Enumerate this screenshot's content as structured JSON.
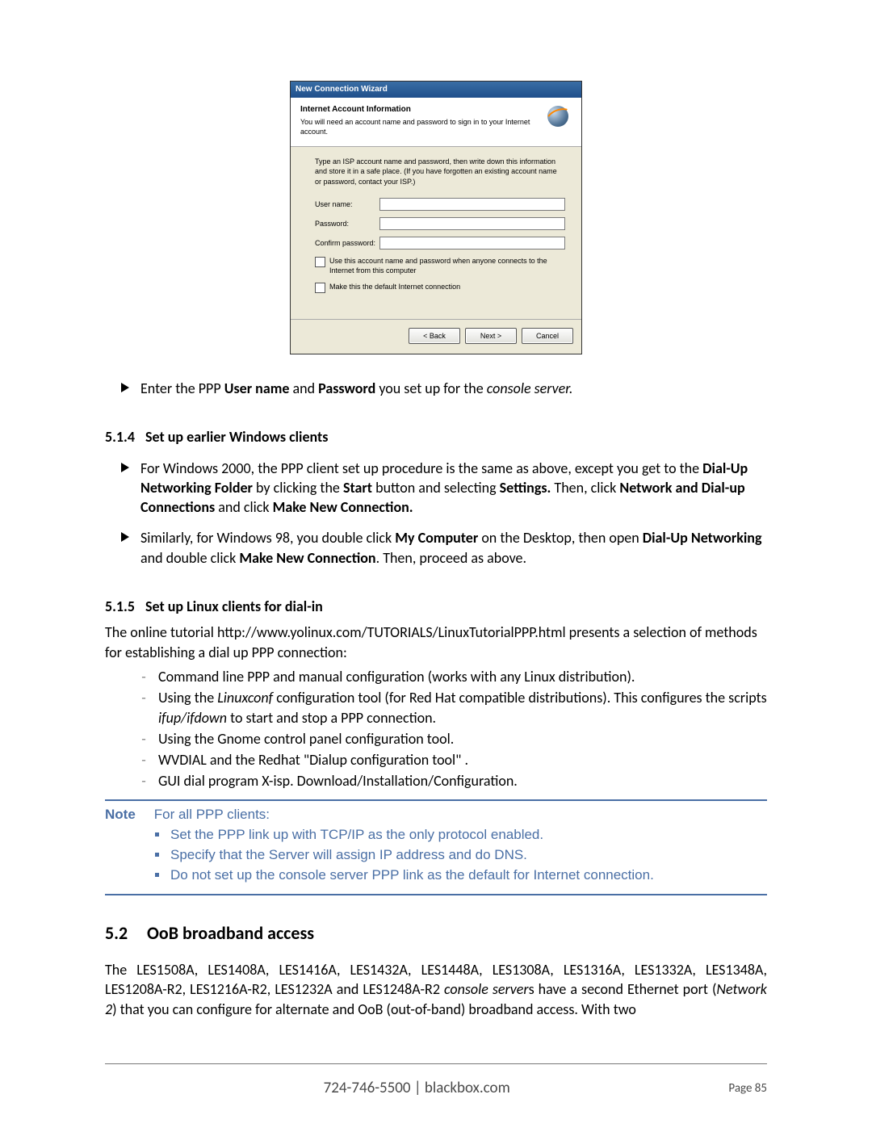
{
  "wizard": {
    "title": "New Connection Wizard",
    "header_title": "Internet Account Information",
    "header_sub": "You will need an account name and password to sign in to your Internet account.",
    "instructions": "Type an ISP account name and password, then write down this information and store it in a safe place. (If you have forgotten an existing account name or password, contact your ISP.)",
    "label_user": "User name:",
    "label_pass": "Password:",
    "label_confirm": "Confirm password:",
    "cb1": "Use this account name and password when anyone connects to the Internet from this computer",
    "cb2": "Make this the default Internet connection",
    "btn_back": "< Back",
    "btn_next": "Next >",
    "btn_cancel": "Cancel"
  },
  "bullet_main": {
    "pre": "Enter the PPP ",
    "b1": "User name",
    "mid1": " and ",
    "b2": "Password",
    "mid2": " you set up for the ",
    "i1": "console server.",
    "suf": ""
  },
  "sec514": {
    "num": "5.1.4",
    "title": "Set up earlier Windows clients",
    "p1": {
      "pre": "For Windows 2000, the PPP client set up procedure is the same as above, except you get to the ",
      "b1": "Dial-Up Networking Folder",
      "t1": " by clicking the ",
      "b2": "Start",
      "t2": " button and selecting ",
      "b3": "Settings.",
      "t3": " Then, click ",
      "b4": "Network and Dial-up Connections",
      "t4": " and click ",
      "b5": "Make New Connection."
    },
    "p2": {
      "pre": "Similarly, for Windows 98, you double click ",
      "b1": "My Computer",
      "t1": " on the Desktop, then open ",
      "b2": "Dial-Up Networking",
      "t2": " and double click ",
      "b3": "Make New Connection",
      "t3": ". Then, proceed as above."
    }
  },
  "sec515": {
    "num": "5.1.5",
    "title": "Set up Linux clients for dial-in",
    "intro": "The online tutorial http://www.yolinux.com/TUTORIALS/LinuxTutorialPPP.html presents a selection of methods for establishing a dial up PPP connection:",
    "items": [
      "Command line PPP and manual configuration (works with any Linux distribution).",
      "",
      "Using the Gnome control panel configuration tool.",
      "WVDIAL and the Redhat \"Dialup configuration tool\" .",
      "GUI dial program X-isp. Download/Installation/Configuration."
    ],
    "item2": {
      "pre": "Using the ",
      "i1": "Linuxconf",
      "t1": " configuration tool (for Red Hat compatible distributions). This configures the scripts ",
      "i2": "ifup/ifdown",
      "t2": " to start and stop a PPP connection."
    }
  },
  "note": {
    "label": "Note",
    "line0": "For all PPP clients:",
    "items": [
      "Set the PPP link up with TCP/IP as the only protocol enabled.",
      "Specify that the Server will assign IP address and do DNS.",
      "Do not set up the console server PPP link as the default for Internet connection."
    ]
  },
  "sec52": {
    "num": "5.2",
    "title": "OoB broadband access",
    "p_pre": "The LES1508A, LES1408A, LES1416A, LES1432A, LES1448A, LES1308A, LES1316A, LES1332A, LES1348A, LES1208A-R2, LES1216A-R2, LES1232A and LES1248A-R2 ",
    "p_i": "console server",
    "p_mid": "s have a second Ethernet port (",
    "p_i2": "Network 2",
    "p_suf": ") that you can configure for alternate and OoB (out-of-band) broadband access. With two"
  },
  "footer": {
    "phone": "724-746-5500",
    "sep": " | ",
    "site": "blackbox.com",
    "page": "Page 85"
  }
}
